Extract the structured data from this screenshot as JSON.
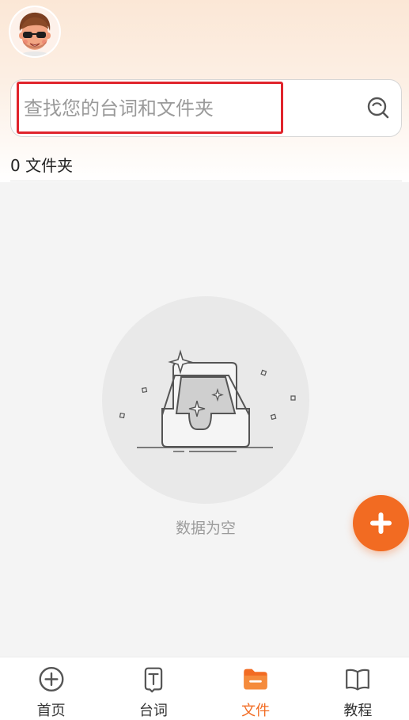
{
  "search": {
    "placeholder": "查找您的台词和文件夹"
  },
  "folder_count_label": "0 文件夹",
  "empty_state": {
    "text": "数据为空"
  },
  "nav": {
    "items": [
      {
        "label": "首页",
        "icon": "plus-circle-icon",
        "active": false
      },
      {
        "label": "台词",
        "icon": "text-document-icon",
        "active": false
      },
      {
        "label": "文件",
        "icon": "folder-icon",
        "active": true
      },
      {
        "label": "教程",
        "icon": "open-book-icon",
        "active": false
      }
    ]
  },
  "colors": {
    "accent": "#f26b22",
    "highlight_border": "#e0242c",
    "background": "#f4f4f4"
  }
}
